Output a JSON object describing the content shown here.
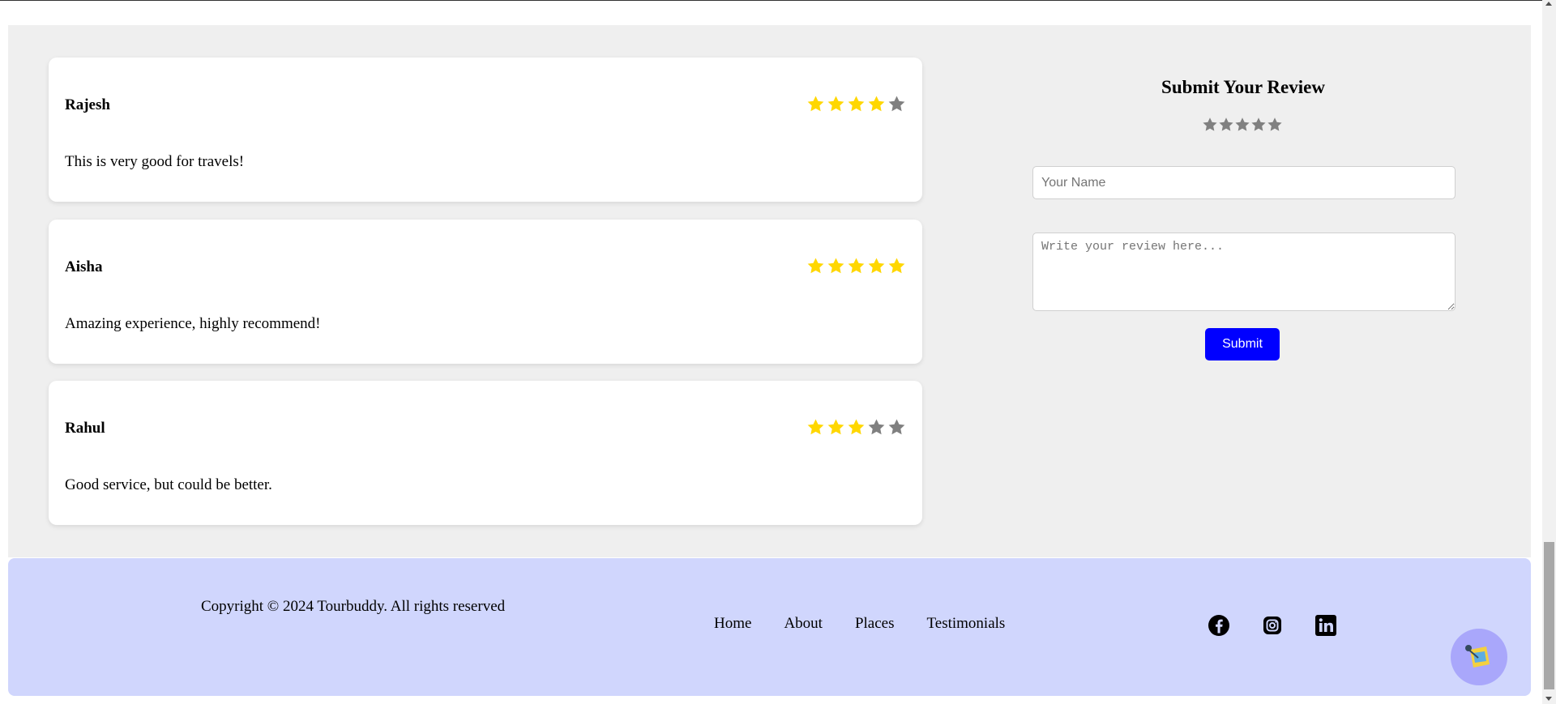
{
  "reviews": [
    {
      "name": "Rajesh",
      "rating": 4,
      "text": "This is very good for travels!"
    },
    {
      "name": "Aisha",
      "rating": 5,
      "text": "Amazing experience, highly recommend!"
    },
    {
      "name": "Rahul",
      "rating": 3,
      "text": "Good service, but could be better."
    }
  ],
  "form": {
    "title": "Submit Your Review",
    "rating": 0,
    "name_placeholder": "Your Name",
    "review_placeholder": "Write your review here...",
    "submit_label": "Submit"
  },
  "footer": {
    "copyright": "Copyright © 2024 Tourbuddy. All rights reserved",
    "nav": [
      "Home",
      "About",
      "Places",
      "Testimonials"
    ],
    "social_icons": [
      "facebook-icon",
      "instagram-icon",
      "linkedin-icon"
    ]
  },
  "chatbot": {
    "icon": "chatbot-icon"
  },
  "colors": {
    "star_filled": "#ffd700",
    "star_empty": "#808080",
    "submit_button": "#0000ff",
    "footer_bg": "#d0d6fd",
    "section_bg": "#efefef",
    "chatbot_bg": "#a9a7fb"
  }
}
